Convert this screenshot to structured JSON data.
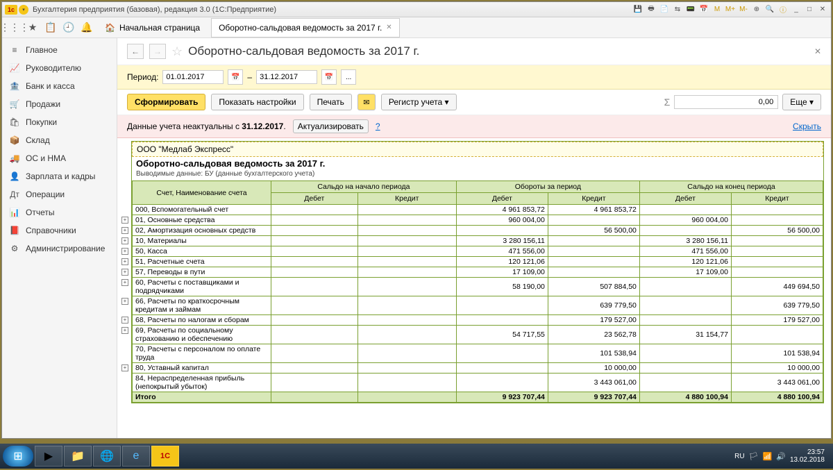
{
  "title": "Бухгалтерия предприятия (базовая), редакция 3.0  (1С:Предприятие)",
  "topnav": {
    "home": "Начальная страница",
    "tab": "Оборотно-сальдовая ведомость за 2017 г."
  },
  "sidebar": [
    {
      "icon": "≡",
      "label": "Главное"
    },
    {
      "icon": "📈",
      "label": "Руководителю"
    },
    {
      "icon": "🏦",
      "label": "Банк и касса"
    },
    {
      "icon": "🛒",
      "label": "Продажи"
    },
    {
      "icon": "🛍",
      "label": "Покупки"
    },
    {
      "icon": "📦",
      "label": "Склад"
    },
    {
      "icon": "🚚",
      "label": "ОС и НМА"
    },
    {
      "icon": "👤",
      "label": "Зарплата и кадры"
    },
    {
      "icon": "Дт",
      "label": "Операции"
    },
    {
      "icon": "📊",
      "label": "Отчеты"
    },
    {
      "icon": "📕",
      "label": "Справочники"
    },
    {
      "icon": "⚙",
      "label": "Администрирование"
    }
  ],
  "page": {
    "title": "Оборотно-сальдовая ведомость за 2017 г.",
    "period_label": "Период:",
    "date_from": "01.01.2017",
    "date_to": "31.12.2017",
    "dash": "–",
    "dots": "..."
  },
  "toolbar": {
    "generate": "Сформировать",
    "settings": "Показать настройки",
    "print": "Печать",
    "register": "Регистр учета ▾",
    "sum": "0,00",
    "more": "Еще ▾"
  },
  "alert": {
    "text1": "Данные учета неактуальны с ",
    "date": "31.12.2017",
    "update": "Актуализировать",
    "q": "?",
    "hide": "Скрыть"
  },
  "report": {
    "org": "ООО \"Медлаб Экспресс\"",
    "title": "Оборотно-сальдовая ведомость за 2017 г.",
    "subtitle": "Выводимые данные:   БУ (данные бухгалтерского учета)",
    "hdr_account": "Счет, Наименование счета",
    "hdr_start": "Сальдо на начало периода",
    "hdr_turn": "Обороты за период",
    "hdr_end": "Сальдо на конец периода",
    "hdr_debit": "Дебет",
    "hdr_credit": "Кредит",
    "total": "Итого",
    "rows": [
      {
        "name": "000, Вспомогательный счет",
        "sd": "",
        "sc": "",
        "td": "4 961 853,72",
        "tc": "4 961 853,72",
        "ed": "",
        "ec": ""
      },
      {
        "name": "01, Основные средства",
        "sd": "",
        "sc": "",
        "td": "960 004,00",
        "tc": "",
        "ed": "960 004,00",
        "ec": ""
      },
      {
        "name": "02, Амортизация основных средств",
        "sd": "",
        "sc": "",
        "td": "",
        "tc": "56 500,00",
        "ed": "",
        "ec": "56 500,00"
      },
      {
        "name": "10, Материалы",
        "sd": "",
        "sc": "",
        "td": "3 280 156,11",
        "tc": "",
        "ed": "3 280 156,11",
        "ec": ""
      },
      {
        "name": "50, Касса",
        "sd": "",
        "sc": "",
        "td": "471 556,00",
        "tc": "",
        "ed": "471 556,00",
        "ec": ""
      },
      {
        "name": "51, Расчетные счета",
        "sd": "",
        "sc": "",
        "td": "120 121,06",
        "tc": "",
        "ed": "120 121,06",
        "ec": ""
      },
      {
        "name": "57, Переводы в пути",
        "sd": "",
        "sc": "",
        "td": "17 109,00",
        "tc": "",
        "ed": "17 109,00",
        "ec": ""
      },
      {
        "name": "60, Расчеты с поставщиками и подрядчиками",
        "sd": "",
        "sc": "",
        "td": "58 190,00",
        "tc": "507 884,50",
        "ed": "",
        "ec": "449 694,50"
      },
      {
        "name": "66, Расчеты по краткосрочным кредитам и займам",
        "sd": "",
        "sc": "",
        "td": "",
        "tc": "639 779,50",
        "ed": "",
        "ec": "639 779,50"
      },
      {
        "name": "68, Расчеты по налогам и сборам",
        "sd": "",
        "sc": "",
        "td": "",
        "tc": "179 527,00",
        "ed": "",
        "ec": "179 527,00"
      },
      {
        "name": "69, Расчеты по социальному страхованию и обеспечению",
        "sd": "",
        "sc": "",
        "td": "54 717,55",
        "tc": "23 562,78",
        "ed": "31 154,77",
        "ec": ""
      },
      {
        "name": "70, Расчеты с персоналом по оплате труда",
        "sd": "",
        "sc": "",
        "td": "",
        "tc": "101 538,94",
        "ed": "",
        "ec": "101 538,94"
      },
      {
        "name": "80, Уставный капитал",
        "sd": "",
        "sc": "",
        "td": "",
        "tc": "10 000,00",
        "ed": "",
        "ec": "10 000,00"
      },
      {
        "name": "84, Нераспределенная прибыль (непокрытый убыток)",
        "sd": "",
        "sc": "",
        "td": "",
        "tc": "3 443 061,00",
        "ed": "",
        "ec": "3 443 061,00"
      }
    ],
    "totals": {
      "sd": "",
      "sc": "",
      "td": "9 923 707,44",
      "tc": "9 923 707,44",
      "ed": "4 880 100,94",
      "ec": "4 880 100,94"
    }
  },
  "tray": {
    "lang": "RU",
    "time": "23:57",
    "date": "13.02.2018"
  }
}
